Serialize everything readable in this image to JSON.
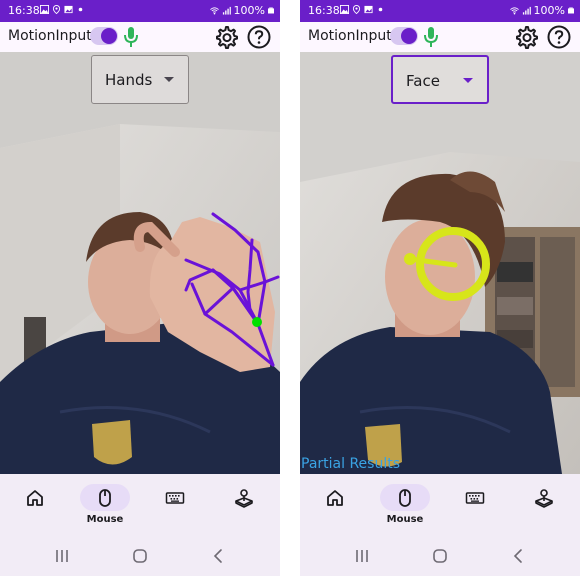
{
  "colors": {
    "accent": "#6a1fc9",
    "mic": "#2fb55a",
    "hand_skeleton": "#6a12d8",
    "hand_point": "#00e000",
    "face_ring": "#d7e51a",
    "partial_results": "#3aa3e3"
  },
  "screens": [
    {
      "status_bar": {
        "time": "16:38",
        "battery": "100%",
        "left_icons": [
          "photo-icon",
          "location-icon",
          "gallery-icon",
          "dot-icon"
        ],
        "right_icons": [
          "wifi-icon",
          "signal-icon",
          "battery-icon"
        ]
      },
      "app_bar": {
        "title": "MotionInput",
        "toggle_on": true,
        "icons": [
          "mic-icon",
          "gear-icon",
          "help-icon"
        ]
      },
      "mode_select": {
        "value": "Hands",
        "focused": false
      },
      "overlay": "hand-skeleton",
      "partial_results": "",
      "bottom_nav": [
        {
          "icon": "home-icon",
          "label": "",
          "selected": false
        },
        {
          "icon": "mouse-icon",
          "label": "Mouse",
          "selected": true
        },
        {
          "icon": "keyboard-icon",
          "label": "",
          "selected": false
        },
        {
          "icon": "joystick-icon",
          "label": "",
          "selected": false
        }
      ],
      "system_nav": [
        "recent-apps-icon",
        "home-circle-icon",
        "back-icon"
      ]
    },
    {
      "status_bar": {
        "time": "16:38",
        "battery": "100%",
        "left_icons": [
          "photo-icon",
          "location-icon",
          "gallery-icon",
          "dot-icon"
        ],
        "right_icons": [
          "wifi-icon",
          "signal-icon",
          "battery-icon"
        ]
      },
      "app_bar": {
        "title": "MotionInput",
        "toggle_on": true,
        "icons": [
          "mic-icon",
          "gear-icon",
          "help-icon"
        ]
      },
      "mode_select": {
        "value": "Face",
        "focused": true
      },
      "overlay": "face-ring",
      "partial_results": "Partial Results",
      "bottom_nav": [
        {
          "icon": "home-icon",
          "label": "",
          "selected": false
        },
        {
          "icon": "mouse-icon",
          "label": "Mouse",
          "selected": true
        },
        {
          "icon": "keyboard-icon",
          "label": "",
          "selected": false
        },
        {
          "icon": "joystick-icon",
          "label": "",
          "selected": false
        }
      ],
      "system_nav": [
        "recent-apps-icon",
        "home-circle-icon",
        "back-icon"
      ]
    }
  ]
}
